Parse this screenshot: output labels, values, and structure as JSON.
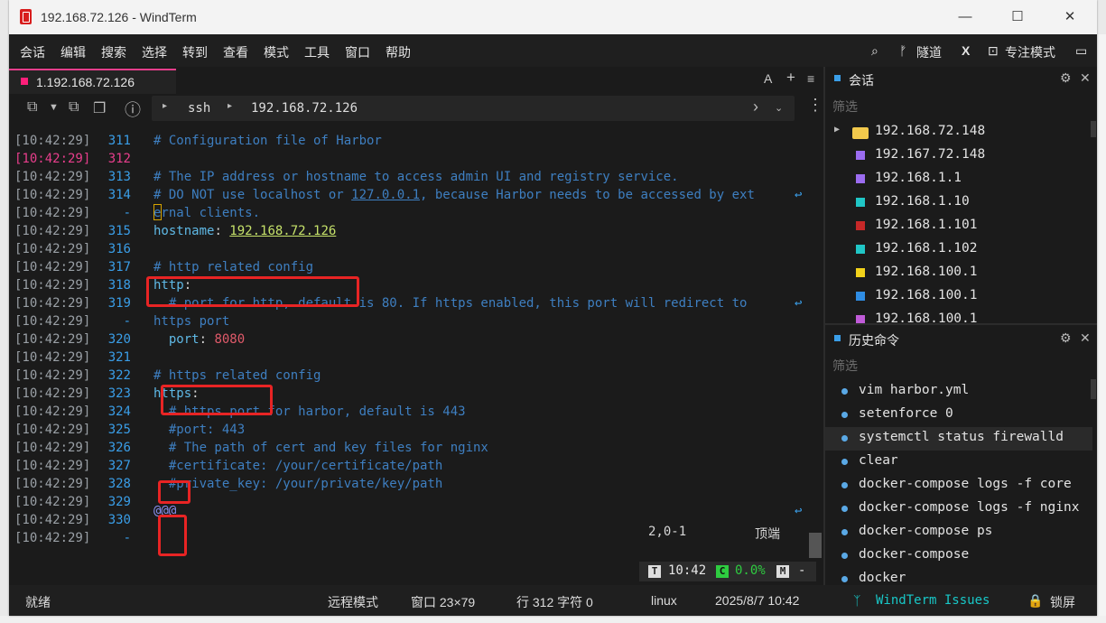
{
  "window": {
    "title": "192.168.72.126 - WindTerm",
    "minimize_glyph": "—",
    "maximize_glyph": "☐",
    "close_glyph": "✕"
  },
  "menu": {
    "items": [
      "会话",
      "编辑",
      "搜索",
      "选择",
      "转到",
      "查看",
      "模式",
      "工具",
      "窗口",
      "帮助"
    ],
    "right": {
      "tunnel_label": "隧道",
      "x_label": "X",
      "focus_label": "专注模式"
    }
  },
  "tab": {
    "label": "1.192.168.72.126",
    "a_label": "A",
    "plus_label": "+",
    "menu_label": "≡"
  },
  "address": {
    "protocol": "ssh",
    "host": "192.168.72.126"
  },
  "editor": {
    "lines": [
      {
        "ts": "[10:42:29]",
        "ln": "311",
        "segs": [
          {
            "t": "# Configuration file of Harbor",
            "c": "cm"
          }
        ]
      },
      {
        "ts": "[10:42:29]",
        "ln": "312",
        "segs": []
      },
      {
        "ts": "[10:42:29]",
        "ln": "313",
        "segs": [
          {
            "t": "# The IP address or hostname to access admin UI and registry service.",
            "c": "cm"
          }
        ]
      },
      {
        "ts": "[10:42:29]",
        "ln": "314",
        "segs": [
          {
            "t": "# DO NOT use localhost or ",
            "c": "cm"
          },
          {
            "t": "127.0.0.1",
            "c": "cm ul"
          },
          {
            "t": ", because Harbor needs to be accessed by ext",
            "c": "cm"
          }
        ],
        "wrap": true
      },
      {
        "ts": "[10:42:29]",
        "ln": "-",
        "segs": [
          {
            "t": "ernal clients.",
            "c": "cm"
          }
        ]
      },
      {
        "ts": "[10:42:29]",
        "ln": "315",
        "segs": [
          {
            "t": "hostname",
            "c": "kw"
          },
          {
            "t": ": ",
            "c": "punc"
          },
          {
            "t": "192.168.72.126",
            "c": "str"
          }
        ]
      },
      {
        "ts": "[10:42:29]",
        "ln": "316",
        "segs": []
      },
      {
        "ts": "[10:42:29]",
        "ln": "317",
        "segs": [
          {
            "t": "# http related config",
            "c": "cm"
          }
        ]
      },
      {
        "ts": "[10:42:29]",
        "ln": "318",
        "segs": [
          {
            "t": "http",
            "c": "kw"
          },
          {
            "t": ":",
            "c": "punc"
          }
        ]
      },
      {
        "ts": "[10:42:29]",
        "ln": "319",
        "segs": [
          {
            "t": "  # port for http, default is 80. If https enabled, this port will redirect to",
            "c": "cm"
          }
        ],
        "wrap": true
      },
      {
        "ts": "[10:42:29]",
        "ln": "-",
        "segs": [
          {
            "t": "https port",
            "c": "cm"
          }
        ]
      },
      {
        "ts": "[10:42:29]",
        "ln": "320",
        "segs": [
          {
            "t": "  port",
            "c": "kw"
          },
          {
            "t": ": ",
            "c": "punc"
          },
          {
            "t": "8080",
            "c": "num"
          }
        ]
      },
      {
        "ts": "[10:42:29]",
        "ln": "321",
        "segs": []
      },
      {
        "ts": "[10:42:29]",
        "ln": "322",
        "segs": [
          {
            "t": "# https related config",
            "c": "cm"
          }
        ]
      },
      {
        "ts": "[10:42:29]",
        "ln": "323",
        "segs": [
          {
            "t": "https",
            "c": "kw"
          },
          {
            "t": ":",
            "c": "punc"
          }
        ]
      },
      {
        "ts": "[10:42:29]",
        "ln": "324",
        "segs": [
          {
            "t": "  # https port for harbor, default is 443",
            "c": "cm"
          }
        ]
      },
      {
        "ts": "[10:42:29]",
        "ln": "325",
        "segs": [
          {
            "t": "  #port: 443",
            "c": "cm"
          }
        ]
      },
      {
        "ts": "[10:42:29]",
        "ln": "326",
        "segs": [
          {
            "t": "  # The path of cert and key files for nginx",
            "c": "cm"
          }
        ]
      },
      {
        "ts": "[10:42:29]",
        "ln": "327",
        "segs": [
          {
            "t": "  #certificate: /your/certificate/path",
            "c": "cm"
          }
        ]
      },
      {
        "ts": "[10:42:29]",
        "ln": "328",
        "segs": [
          {
            "t": "  #private_key: /your/private/key/path",
            "c": "cm"
          }
        ]
      },
      {
        "ts": "[10:42:29]",
        "ln": "329",
        "segs": []
      },
      {
        "ts": "[10:42:29]",
        "ln": "330",
        "segs": []
      },
      {
        "ts": "[10:42:29]",
        "ln": "-",
        "segs": []
      }
    ],
    "eof_marker": "@@@",
    "cursor_pos": "2,0-1",
    "position_word": "顶端"
  },
  "mini_status": {
    "time": "10:42",
    "percent": "0.0%",
    "dash": "-",
    "t_badge": "T",
    "c_badge": "C",
    "m_badge": "M"
  },
  "sessions": {
    "title": "会话",
    "filter_placeholder": "筛选",
    "items": [
      {
        "label": "192.168.72.148",
        "color": "#f2c94c",
        "folder": true
      },
      {
        "label": "192.167.72.148",
        "color": "#9b6cf0"
      },
      {
        "label": "192.168.1.1",
        "color": "#9b6cf0"
      },
      {
        "label": "192.168.1.10",
        "color": "#20c6c6"
      },
      {
        "label": "192.168.1.101",
        "color": "#c62828"
      },
      {
        "label": "192.168.1.102",
        "color": "#20c6c6"
      },
      {
        "label": "192.168.100.1",
        "color": "#f2d21b"
      },
      {
        "label": "192.168.100.1",
        "color": "#2f8de4"
      },
      {
        "label": "192.168.100.1",
        "color": "#c05bd8"
      }
    ]
  },
  "history": {
    "title": "历史命令",
    "filter_placeholder": "筛选",
    "items": [
      "vim harbor.yml",
      "setenforce 0",
      "systemctl status firewalld",
      "clear",
      "docker-compose logs -f core",
      "docker-compose logs -f nginx",
      "docker-compose ps",
      "docker-compose",
      "docker"
    ]
  },
  "statusbar": {
    "ready": "就绪",
    "remote_mode": "远程模式",
    "window_size": "窗口 23×79",
    "row_col": "行 312 字符 0",
    "os": "linux",
    "datetime": "2025/8/7 10:42",
    "issues": "WindTerm Issues",
    "lock": "锁屏"
  },
  "colors": {
    "accent_pink": "#e83e8c",
    "accent_blue": "#3a9ee8",
    "highlight_red": "#e82424",
    "issues_cyan": "#18c8c8"
  }
}
